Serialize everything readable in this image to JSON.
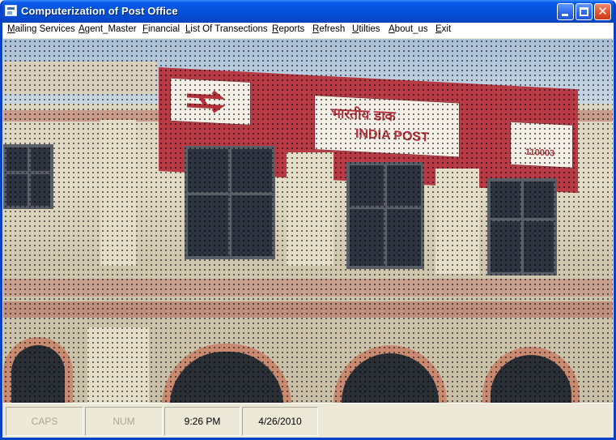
{
  "window": {
    "title": "Computerization of Post Office",
    "close_glyph": "✕"
  },
  "menu": [
    {
      "label": "Mailing Services",
      "acc": "M",
      "rest": "ailing Services"
    },
    {
      "label": "Agent_Master",
      "acc": "A",
      "rest": "gent_Master"
    },
    {
      "label": "Financial",
      "acc": "F",
      "rest": "inancial"
    },
    {
      "label": "List Of Transections",
      "acc": "L",
      "rest": "ist Of Transections"
    },
    {
      "label": "Reports",
      "acc": "R",
      "rest": "eports"
    },
    {
      "label": "Refresh",
      "acc": "R",
      "rest": "efresh"
    },
    {
      "label": "Utilties",
      "acc": "U",
      "rest": "tilties"
    },
    {
      "label": "About_us",
      "acc": "A",
      "rest": "bout_us"
    },
    {
      "label": "Exit",
      "acc": "E",
      "rest": "xit"
    }
  ],
  "background_image": {
    "sign_hindi": "भारतीय डाक",
    "sign_english": "INDIA POST",
    "sign_pin": "110003"
  },
  "statusbar": {
    "caps": "CAPS",
    "num": "NUM",
    "time": "9:26 PM",
    "date": "4/26/2010"
  },
  "colors": {
    "titlebar": "#0351d8",
    "sign_red": "#b73a45",
    "disabled_text": "#aca899"
  }
}
